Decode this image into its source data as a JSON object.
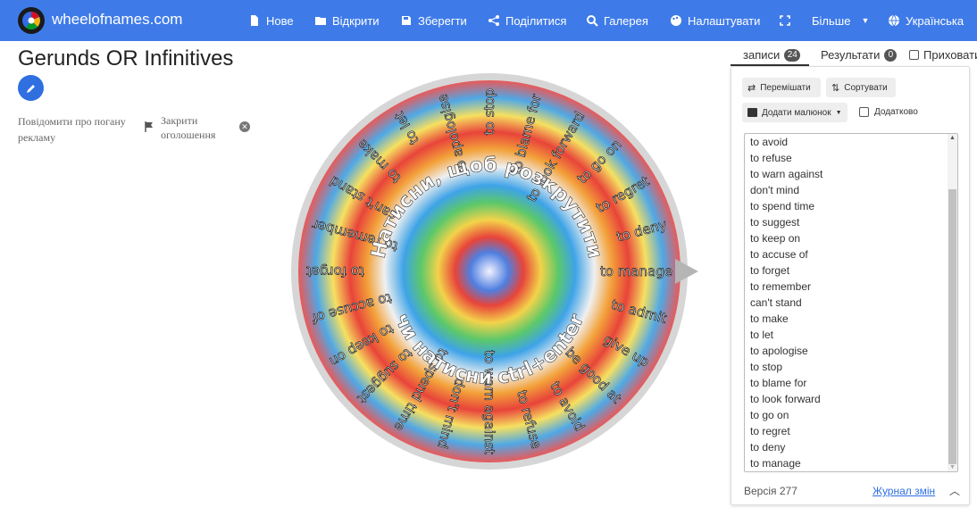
{
  "header": {
    "site_name": "wheelofnames.com",
    "nav": [
      {
        "label": "Нове",
        "icon": "file-icon"
      },
      {
        "label": "Відкрити",
        "icon": "folder-open-icon"
      },
      {
        "label": "Зберегти",
        "icon": "save-icon"
      },
      {
        "label": "Поділитися",
        "icon": "share-icon"
      },
      {
        "label": "Галерея",
        "icon": "search-icon"
      },
      {
        "label": "Налаштувати",
        "icon": "palette-icon"
      },
      {
        "label": "",
        "icon": "fullscreen-icon"
      },
      {
        "label": "Більше",
        "icon": "chevron-down-icon"
      },
      {
        "label": "Українська",
        "icon": "globe-icon"
      }
    ]
  },
  "main": {
    "title": "Gerunds OR Infinitives",
    "ad_report": "Повідомити про погану рекламу",
    "ad_close": "Закрити оголошення"
  },
  "wheel": {
    "center_text_top": "Натисни, щоб розкрутити",
    "center_text_bottom": "чи натисни ctrl+enter",
    "segments": [
      "to avoid",
      "to refuse",
      "to warn against",
      "don't mind",
      "to spend time",
      "to suggest",
      "to keep on",
      "to accuse of",
      "to forget",
      "to remember",
      "can't stand",
      "to make",
      "to let",
      "to apologise",
      "to stop",
      "to blame for",
      "to look forward",
      "to go on",
      "to regret",
      "to deny",
      "to manage",
      "to admit",
      "give up",
      "be good at"
    ],
    "colors": {
      "pointer": "#b5b5b5",
      "rim": "#d6d6d6"
    }
  },
  "sidebar": {
    "tabs": [
      {
        "label": "записи",
        "count": "24"
      },
      {
        "label": "Результати",
        "count": "0"
      },
      {
        "label": "Приховати"
      }
    ],
    "buttons": {
      "shuffle": "Перемішати",
      "sort": "Сортувати",
      "add_image": "Додати малюнок",
      "advanced": "Додатково"
    },
    "entries": [
      "to avoid",
      "to refuse",
      "to warn against",
      "don't mind",
      "to spend time",
      "to suggest",
      "to keep on",
      "to accuse of",
      "to forget",
      "to remember",
      "can't stand",
      "to make",
      "to let",
      "to apologise",
      "to stop",
      "to blame for",
      "to look forward",
      "to go on",
      "to regret",
      "to deny",
      "to manage"
    ],
    "version": "Версія 277",
    "changelog": "Журнал змін"
  }
}
